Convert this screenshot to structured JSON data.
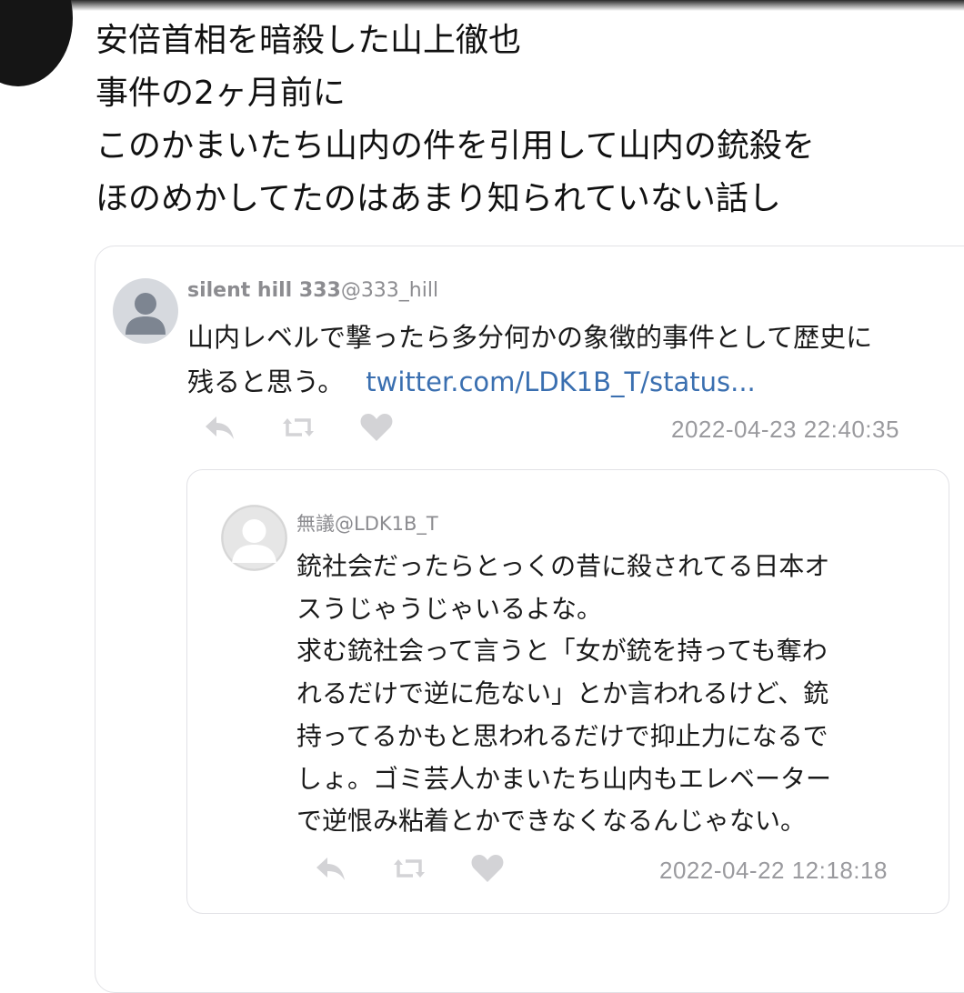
{
  "main_post": {
    "lines": [
      "安倍首相を暗殺した山上徹也",
      "事件の2ヶ月前に",
      "このかまいたち山内の件を引用して山内の銃殺を",
      "ほのめかしてたのはあまり知られていない話し"
    ]
  },
  "quoted_tweet": {
    "display_name": "silent hill 333",
    "handle": "@333_hill",
    "text_lines": [
      "山内レベルで撃ったら多分何かの象徴的事件として歴史に",
      "残ると思う。"
    ],
    "link": "twitter.com/LDK1B_T/status...",
    "timestamp": "2022-04-23 22:40:35",
    "icons": [
      "reply-icon",
      "retweet-icon",
      "like-icon"
    ]
  },
  "nested_tweet": {
    "display_name": "無議",
    "handle": "@LDK1B_T",
    "text_lines": [
      "銃社会だったらとっくの昔に殺されてる日本オ",
      "スうじゃうじゃいるよな。",
      "求む銃社会って言うと「女が銃を持っても奪わ",
      "れるだけで逆に危ない」とか言われるけど、銃",
      "持ってるかもと思われるだけで抑止力になるで",
      "しょ。ゴミ芸人かまいたち山内もエレベーター",
      "で逆恨み粘着とかできなくなるんじゃない。"
    ],
    "timestamp": "2022-04-22 12:18:18",
    "icons": [
      "reply-icon",
      "retweet-icon",
      "like-icon"
    ]
  },
  "colors": {
    "link": "#3a6fb0",
    "meta_text": "#9a9a9e",
    "icon": "#d0d0d4",
    "card_border": "#e2e2e6"
  }
}
